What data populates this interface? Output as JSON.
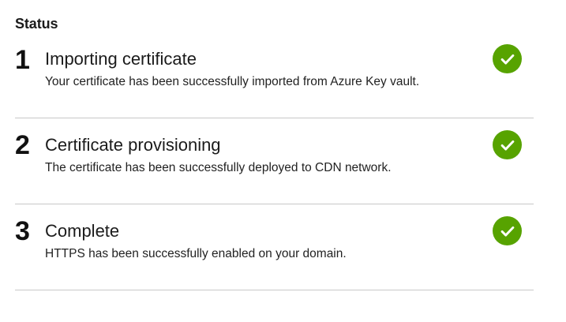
{
  "status": {
    "title": "Status"
  },
  "steps": [
    {
      "number": "1",
      "title": "Importing certificate",
      "description": "Your certificate has been successfully imported from Azure Key vault.",
      "state_icon": "checkmark-circle-icon",
      "state": "complete"
    },
    {
      "number": "2",
      "title": "Certificate provisioning",
      "description": "The certificate has been successfully deployed to CDN network.",
      "state_icon": "checkmark-circle-icon",
      "state": "complete"
    },
    {
      "number": "3",
      "title": "Complete",
      "description": "HTTPS has been successfully enabled on your domain.",
      "state_icon": "checkmark-circle-icon",
      "state": "complete"
    }
  ],
  "colors": {
    "success": "#57a300",
    "divider": "#c8c8c8",
    "text": "#1b1b1b"
  }
}
